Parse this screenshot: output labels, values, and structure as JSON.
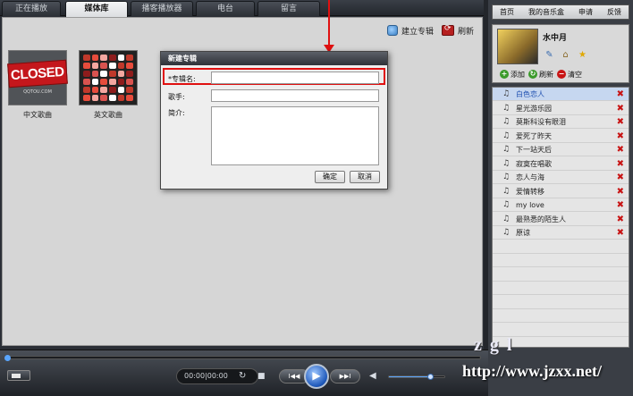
{
  "tabs": [
    {
      "label": "正在播放",
      "active": false
    },
    {
      "label": "媒体库",
      "active": true
    },
    {
      "label": "播客播放器",
      "active": false
    },
    {
      "label": "电台",
      "active": false
    },
    {
      "label": "留言",
      "active": false
    }
  ],
  "toolbar": {
    "create_album": "建立专辑",
    "refresh": "刷新"
  },
  "albums": [
    {
      "label": "中文歌曲",
      "sign_text": "CLOSED",
      "sign_sub": "QQTOU.COM"
    },
    {
      "label": "英文歌曲"
    }
  ],
  "dialog": {
    "title": "新建专辑",
    "album_name_label": "*专辑名:",
    "album_name_value": "",
    "singer_label": "歌手:",
    "singer_value": "",
    "intro_label": "简介:",
    "ok": "确定",
    "cancel": "取消"
  },
  "side_nav": [
    "首页",
    "我的音乐盒",
    "申请",
    "反馈"
  ],
  "profile": {
    "name": "水中月",
    "icons": [
      "pencil-icon",
      "home-icon",
      "star-icon"
    ]
  },
  "side_actions": {
    "add": "添加",
    "refresh": "刷新",
    "clear": "清空"
  },
  "playlist": [
    {
      "title": "白色恋人",
      "selected": true
    },
    {
      "title": "星光游乐园",
      "selected": false
    },
    {
      "title": "莫斯科没有眼泪",
      "selected": false
    },
    {
      "title": "爱死了昨天",
      "selected": false
    },
    {
      "title": "下一站天后",
      "selected": false
    },
    {
      "title": "寂寞在唱歌",
      "selected": false
    },
    {
      "title": "恋人与海",
      "selected": false
    },
    {
      "title": "爱情转移",
      "selected": false
    },
    {
      "title": "my love",
      "selected": false
    },
    {
      "title": "最熟悉的陌生人",
      "selected": false
    },
    {
      "title": "原谅",
      "selected": false
    }
  ],
  "player": {
    "time": "00:00|00:00",
    "progress": 0,
    "volume": 0.75,
    "prev_label": "I◀◀",
    "next_label": "▶▶I"
  },
  "watermark": {
    "mark": "zgl",
    "url": "http://www.jzxx.net/"
  },
  "colors": {
    "highlight": "#e01010",
    "selected_row": "#c6d7f0",
    "delete_x": "#c81414"
  }
}
